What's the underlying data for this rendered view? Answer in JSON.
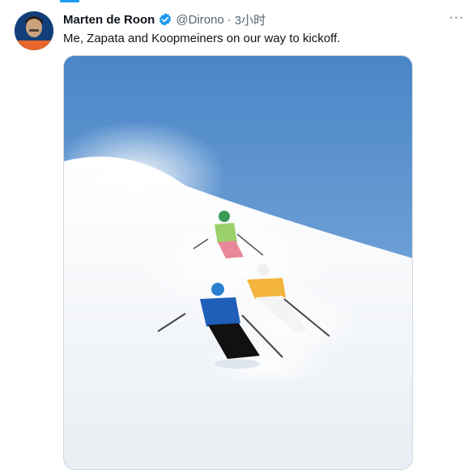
{
  "tweet": {
    "author_name": "Marten de Roon",
    "handle": "@Dirono",
    "separator": "·",
    "time": "3小时",
    "text": "Me, Zapata and Koopmeiners on our way to kickoff."
  },
  "icons": {
    "verified": "verified-badge-icon",
    "more": "more-options-icon"
  },
  "colors": {
    "accent": "#1d9bf0",
    "text_primary": "#0f1419",
    "text_secondary": "#536471"
  }
}
